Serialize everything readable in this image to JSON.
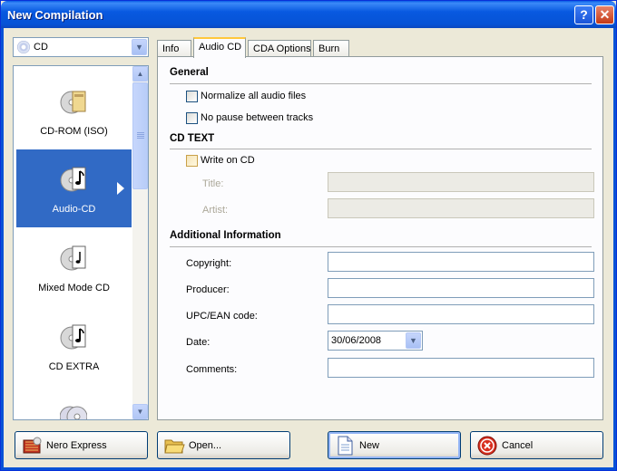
{
  "window": {
    "title": "New Compilation",
    "help_button": "?",
    "close_button": "✕"
  },
  "disc_type": {
    "selected": "CD",
    "icon": "cd-icon"
  },
  "compilation_list": {
    "items": [
      {
        "label": "CD-ROM (ISO)",
        "icon": "cd-rom-iso-icon",
        "selected": false
      },
      {
        "label": "Audio-CD",
        "icon": "audio-cd-icon",
        "selected": true
      },
      {
        "label": "Mixed Mode CD",
        "icon": "mixed-mode-cd-icon",
        "selected": false
      },
      {
        "label": "CD EXTRA",
        "icon": "cd-extra-icon",
        "selected": false
      },
      {
        "label": "",
        "icon": "cd-copy-icon",
        "selected": false
      }
    ]
  },
  "tabs": [
    {
      "label": "Info",
      "active": false
    },
    {
      "label": "Audio CD",
      "active": true
    },
    {
      "label": "CDA Options",
      "active": false
    },
    {
      "label": "Burn",
      "active": false
    }
  ],
  "panel": {
    "general": {
      "heading": "General",
      "normalize_label": "Normalize all audio files",
      "normalize_accel": "N",
      "normalize_checked": false,
      "nopause_label": "No pause between tracks",
      "nopause_checked": false
    },
    "cd_text": {
      "heading": "CD TEXT",
      "write_label": "Write on CD",
      "write_checked": false,
      "title_label": "Title:",
      "title_value": "",
      "artist_label": "Artist:",
      "artist_value": ""
    },
    "additional": {
      "heading": "Additional Information",
      "copyright_label": "Copyright:",
      "copyright_value": "",
      "producer_label": "Producer:",
      "producer_value": "",
      "upc_label": "UPC/EAN code:",
      "upc_value": "",
      "date_label": "Date:",
      "date_value": "30/06/2008",
      "comments_label": "Comments:",
      "comments_value": ""
    }
  },
  "buttons": {
    "nero_express": "Nero Express",
    "open": "Open...",
    "new": "New",
    "cancel": "Cancel"
  }
}
